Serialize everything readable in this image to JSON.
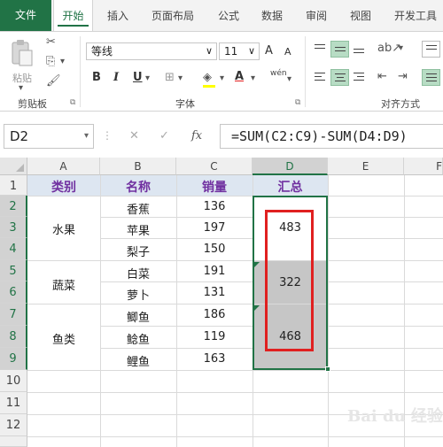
{
  "ribbon": {
    "tabs": [
      "文件",
      "开始",
      "插入",
      "页面布局",
      "公式",
      "数据",
      "审阅",
      "视图",
      "开发工具"
    ],
    "active_tab": "开始",
    "paste_label": "粘贴",
    "clipboard_label": "剪贴板",
    "font_label": "字体",
    "align_label": "对齐方式",
    "font_name": "等线",
    "font_size": "11",
    "bold": "B",
    "italic": "I",
    "underline": "U",
    "grow_font": "A",
    "shrink_font": "A",
    "font_color": "A",
    "phonetic": "wén"
  },
  "formula_bar": {
    "name_box": "D2",
    "formula": "=SUM(C2:C9)-SUM(D4:D9)",
    "fx": "fx"
  },
  "grid": {
    "columns": [
      "A",
      "B",
      "C",
      "D",
      "E",
      "F"
    ],
    "rows": [
      "1",
      "2",
      "3",
      "4",
      "5",
      "6",
      "7",
      "8",
      "9",
      "10",
      "11",
      "12"
    ],
    "headers": {
      "category": "类别",
      "name": "名称",
      "sales": "销量",
      "total": "汇总"
    },
    "categories": [
      "水果",
      "蔬菜",
      "鱼类"
    ],
    "names": [
      "香蕉",
      "苹果",
      "梨子",
      "白菜",
      "萝卜",
      "鲫鱼",
      "鲶鱼",
      "鲤鱼"
    ],
    "sales": [
      "136",
      "197",
      "150",
      "191",
      "131",
      "186",
      "119",
      "163"
    ],
    "totals": [
      "483",
      "322",
      "468"
    ]
  },
  "colors": {
    "accent": "#217346",
    "header_text": "#7030a0",
    "header_band": "#dde6f1",
    "highlight_border": "#e02020"
  },
  "watermark": "Bai du 经验"
}
